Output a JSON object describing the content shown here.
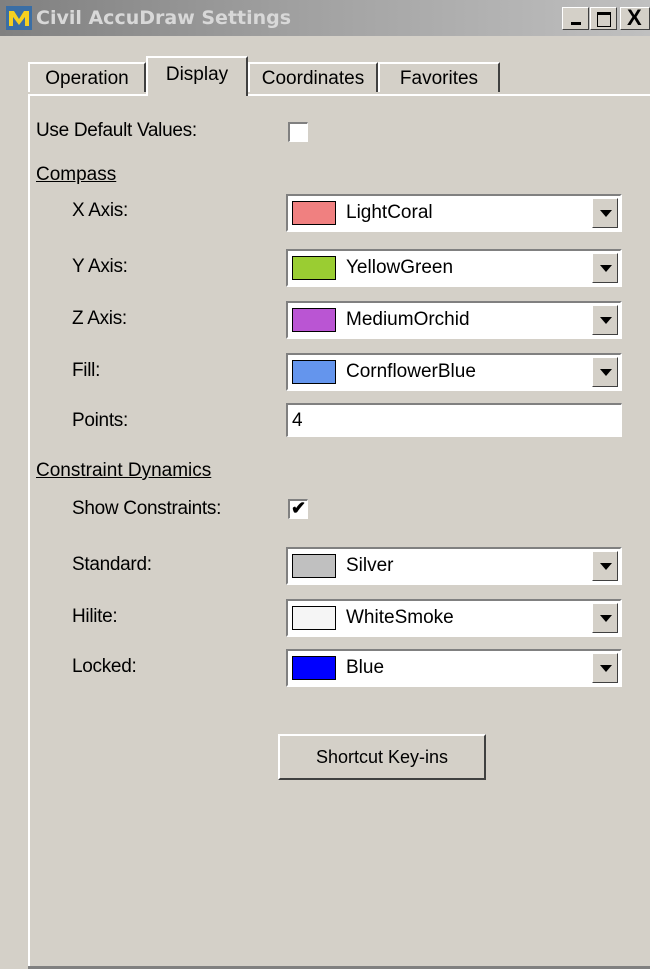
{
  "window": {
    "title": "Civil AccuDraw Settings",
    "icon": "microstation-app-icon",
    "controls": {
      "minimize": "minimize-icon",
      "maximize": "maximize-icon",
      "close": "X"
    }
  },
  "tabs": [
    {
      "label": "Operation",
      "selected": false
    },
    {
      "label": "Display",
      "selected": true
    },
    {
      "label": "Coordinates",
      "selected": false
    },
    {
      "label": "Favorites",
      "selected": false
    }
  ],
  "display": {
    "use_default_values": {
      "label": "Use Default Values:",
      "checked": false
    },
    "compass": {
      "heading": "Compass",
      "x_axis": {
        "label": "X Axis:",
        "value": "LightCoral",
        "color": "#F08080"
      },
      "y_axis": {
        "label": "Y Axis:",
        "value": "YellowGreen",
        "color": "#9ACD32"
      },
      "z_axis": {
        "label": "Z Axis:",
        "value": "MediumOrchid",
        "color": "#BA55D3"
      },
      "fill": {
        "label": "Fill:",
        "value": "CornflowerBlue",
        "color": "#6495ED"
      },
      "points": {
        "label": "Points:",
        "value": "4"
      }
    },
    "constraint_dynamics": {
      "heading": "Constraint Dynamics",
      "show_constraints": {
        "label": "Show Constraints:",
        "checked": true
      },
      "standard": {
        "label": "Standard:",
        "value": "Silver",
        "color": "#C0C0C0"
      },
      "hilite": {
        "label": "Hilite:",
        "value": "WhiteSmoke",
        "color": "#F5F5F5"
      },
      "locked": {
        "label": "Locked:",
        "value": "Blue",
        "color": "#0000FF"
      }
    },
    "shortcut_button": "Shortcut Key-ins"
  }
}
